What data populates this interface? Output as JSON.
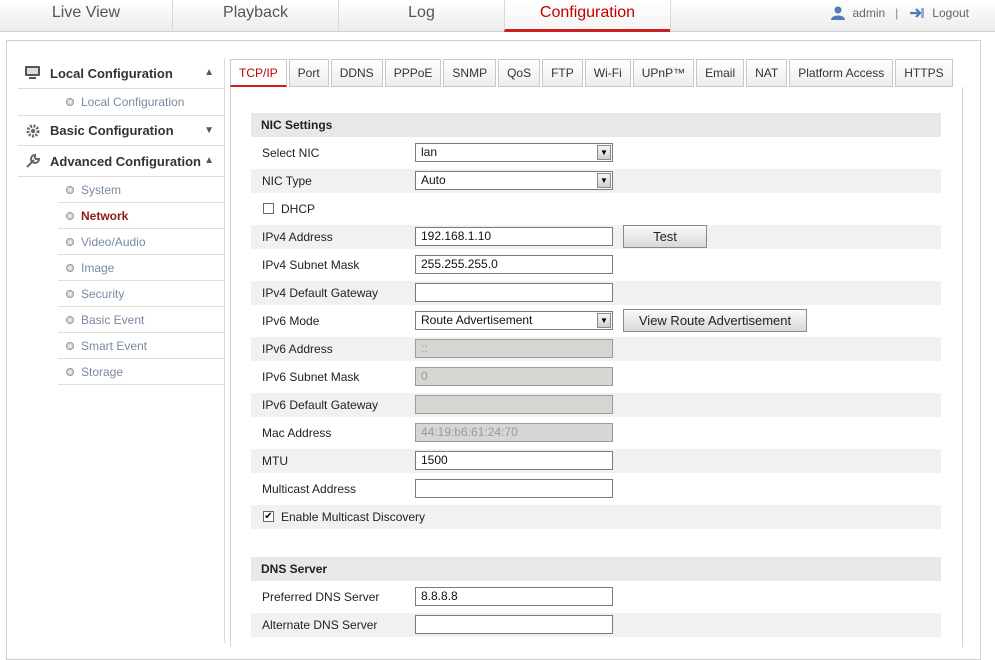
{
  "nav": {
    "tabs": [
      "Live View",
      "Playback",
      "Log",
      "Configuration"
    ],
    "user": "admin",
    "separator": "|",
    "logout": "Logout"
  },
  "sidebar": {
    "local": {
      "label": "Local Configuration",
      "items": [
        "Local Configuration"
      ]
    },
    "basic": {
      "label": "Basic Configuration"
    },
    "advanced": {
      "label": "Advanced Configuration",
      "items": [
        "System",
        "Network",
        "Video/Audio",
        "Image",
        "Security",
        "Basic Event",
        "Smart Event",
        "Storage"
      ]
    }
  },
  "tabs": [
    "TCP/IP",
    "Port",
    "DDNS",
    "PPPoE",
    "SNMP",
    "QoS",
    "FTP",
    "Wi-Fi",
    "UPnP™",
    "Email",
    "NAT",
    "Platform Access",
    "HTTPS"
  ],
  "nic": {
    "title": "NIC Settings",
    "select_nic_label": "Select NIC",
    "select_nic_value": "lan",
    "nic_type_label": "NIC Type",
    "nic_type_value": "Auto",
    "dhcp_label": "DHCP",
    "ipv4_address_label": "IPv4 Address",
    "ipv4_address_value": "192.168.1.10",
    "test_button": "Test",
    "ipv4_mask_label": "IPv4 Subnet Mask",
    "ipv4_mask_value": "255.255.255.0",
    "ipv4_gateway_label": "IPv4 Default Gateway",
    "ipv4_gateway_value": "",
    "ipv6_mode_label": "IPv6 Mode",
    "ipv6_mode_value": "Route Advertisement",
    "view_route_button": "View Route Advertisement",
    "ipv6_address_label": "IPv6 Address",
    "ipv6_address_value": "::",
    "ipv6_mask_label": "IPv6 Subnet Mask",
    "ipv6_mask_value": "0",
    "ipv6_gateway_label": "IPv6 Default Gateway",
    "ipv6_gateway_value": "",
    "mac_label": "Mac Address",
    "mac_value": "44:19:b6:61:24:70",
    "mtu_label": "MTU",
    "mtu_value": "1500",
    "multicast_label": "Multicast Address",
    "multicast_value": "",
    "multicast_discovery_label": "Enable Multicast Discovery",
    "multicast_discovery_checked": true,
    "dhcp_checked": false
  },
  "dns": {
    "title": "DNS Server",
    "preferred_label": "Preferred DNS Server",
    "preferred_value": "8.8.8.8",
    "alternate_label": "Alternate DNS Server",
    "alternate_value": ""
  },
  "colors": {
    "accent": "#cc2020",
    "active_text": "#c00000",
    "row_shade": "#f1f1f1",
    "section_bg": "#e8e8e8"
  }
}
